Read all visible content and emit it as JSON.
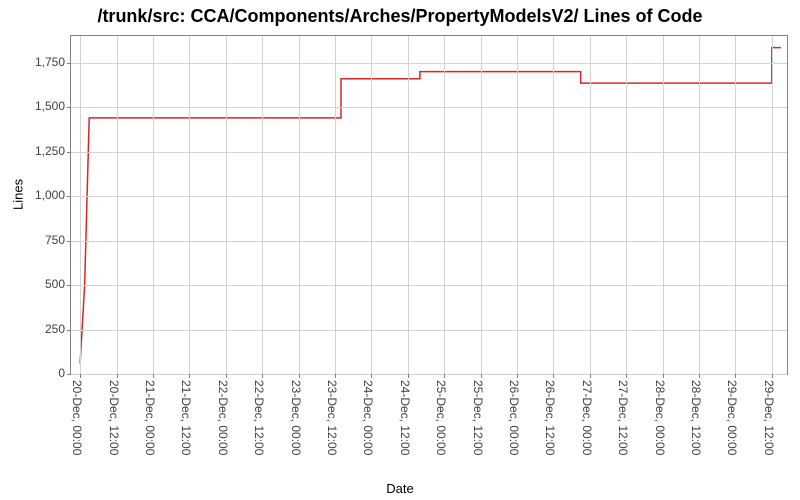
{
  "chart_data": {
    "type": "line",
    "title": "/trunk/src: CCA/Components/Arches/PropertyModelsV2/ Lines of Code",
    "xlabel": "Date",
    "ylabel": "Lines",
    "y_ticks": [
      0,
      250,
      500,
      750,
      1000,
      1250,
      1500,
      1750
    ],
    "ylim": [
      0,
      1900
    ],
    "x_tick_labels": [
      "20-Dec, 00:00",
      "20-Dec, 12:00",
      "21-Dec, 00:00",
      "21-Dec, 12:00",
      "22-Dec, 00:00",
      "22-Dec, 12:00",
      "23-Dec, 00:00",
      "23-Dec, 12:00",
      "24-Dec, 00:00",
      "24-Dec, 12:00",
      "25-Dec, 00:00",
      "25-Dec, 12:00",
      "26-Dec, 00:00",
      "26-Dec, 12:00",
      "27-Dec, 00:00",
      "27-Dec, 12:00",
      "28-Dec, 00:00",
      "28-Dec, 12:00",
      "29-Dec, 00:00",
      "29-Dec, 12:00"
    ],
    "x_tick_values": [
      0,
      12,
      24,
      36,
      48,
      60,
      72,
      84,
      96,
      108,
      120,
      132,
      144,
      156,
      168,
      180,
      192,
      204,
      216,
      228
    ],
    "xlim": [
      -3,
      233
    ],
    "series": [
      {
        "name": "lines-of-code",
        "color": "#d62728",
        "points": [
          {
            "x_hours": 0,
            "y": 60
          },
          {
            "x_hours": 1.5,
            "y": 500
          },
          {
            "x_hours": 3,
            "y": 1440
          },
          {
            "x_hours": 86,
            "y": 1440
          },
          {
            "x_hours": 86,
            "y": 1660
          },
          {
            "x_hours": 112,
            "y": 1660
          },
          {
            "x_hours": 112,
            "y": 1700
          },
          {
            "x_hours": 165,
            "y": 1700
          },
          {
            "x_hours": 165,
            "y": 1635
          },
          {
            "x_hours": 228,
            "y": 1635
          },
          {
            "x_hours": 228,
            "y": 1835
          },
          {
            "x_hours": 231,
            "y": 1835
          }
        ]
      }
    ]
  }
}
